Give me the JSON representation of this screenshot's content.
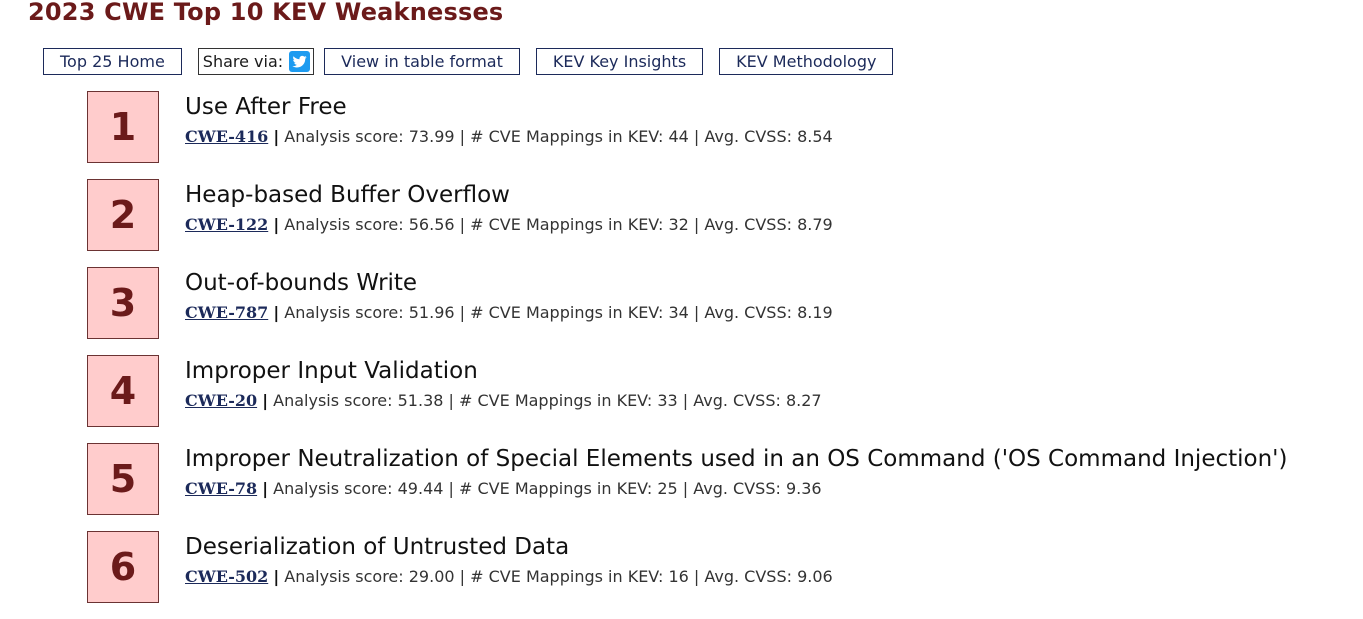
{
  "page": {
    "title": "2023 CWE Top 10 KEV Weaknesses"
  },
  "toolbar": {
    "home_label": "Top 25 Home",
    "share_label": "Share via:",
    "share_icon": "twitter-icon",
    "table_label": "View in table format",
    "insights_label": "KEV Key Insights",
    "methodology_label": "KEV Methodology"
  },
  "labels": {
    "separator": "|",
    "analysis_prefix": "Analysis score:",
    "mappings_prefix": "# CVE Mappings in KEV:",
    "cvss_prefix": "Avg. CVSS:"
  },
  "colors": {
    "title": "#6b1a1a",
    "rank_box_bg": "#ffcccc",
    "link": "#1c2a5a",
    "twitter": "#1d9bf0"
  },
  "items": [
    {
      "rank": "1",
      "name": "Use After Free",
      "cwe": "CWE-416",
      "score": "73.99",
      "mappings": "44",
      "cvss": "8.54"
    },
    {
      "rank": "2",
      "name": "Heap-based Buffer Overflow",
      "cwe": "CWE-122",
      "score": "56.56",
      "mappings": "32",
      "cvss": "8.79"
    },
    {
      "rank": "3",
      "name": "Out-of-bounds Write",
      "cwe": "CWE-787",
      "score": "51.96",
      "mappings": "34",
      "cvss": "8.19"
    },
    {
      "rank": "4",
      "name": "Improper Input Validation",
      "cwe": "CWE-20",
      "score": "51.38",
      "mappings": "33",
      "cvss": "8.27"
    },
    {
      "rank": "5",
      "name": "Improper Neutralization of Special Elements used in an OS Command ('OS Command Injection')",
      "cwe": "CWE-78",
      "score": "49.44",
      "mappings": "25",
      "cvss": "9.36"
    },
    {
      "rank": "6",
      "name": "Deserialization of Untrusted Data",
      "cwe": "CWE-502",
      "score": "29.00",
      "mappings": "16",
      "cvss": "9.06"
    }
  ]
}
